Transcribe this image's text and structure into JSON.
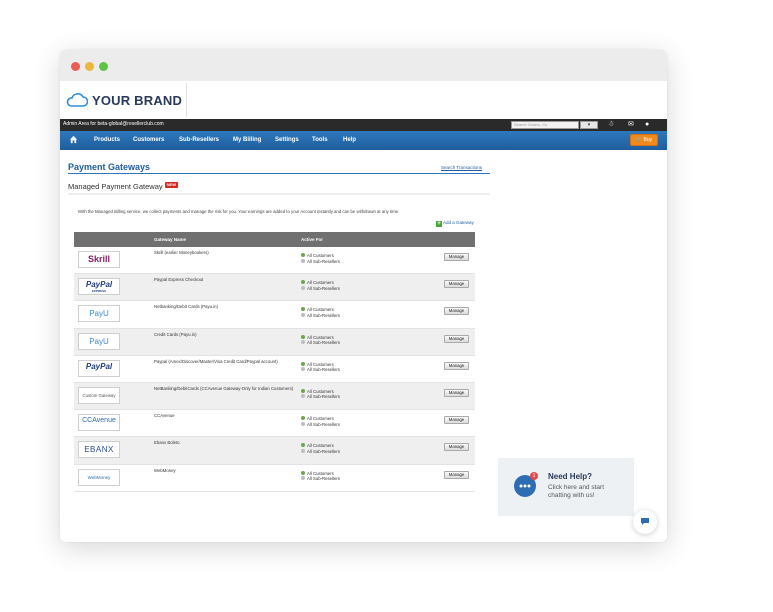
{
  "brand": {
    "name": "YOUR BRAND"
  },
  "admin_bar": {
    "text": "Admin Area for beta-global@resellerclub.com",
    "search_placeholder": "Search Orders, Cu",
    "search_button": "▾"
  },
  "nav": {
    "items": [
      "Products",
      "Customers",
      "Sub-Resellers",
      "My Billing",
      "Settings",
      "Tools",
      "Help"
    ],
    "buy_label": "🛒 Buy"
  },
  "page": {
    "title": "Payment Gateways",
    "search_transactions": "Search Transactions",
    "subtitle": "Managed Payment Gateway",
    "new_badge": "NEW",
    "description": "With the Managed Billing service, we collect payments and manage the risk for you. Your earnings are added to your Account instantly and can be withdrawn at any time.",
    "add_gateway": "Add a Gateway"
  },
  "table": {
    "headers": {
      "name": "Gateway Name",
      "active": "Active For"
    },
    "manage_label": "Manage",
    "rows": [
      {
        "logo": "Skrill",
        "name": "Skrill (earlier Moneybookers)",
        "active": [
          "All Customers",
          "All Sub-Resellers"
        ]
      },
      {
        "logo": "PayPal",
        "logo_sub": "EXPRESS",
        "name": "Paypal Express Checkout",
        "active": [
          "All Customers",
          "All Sub-Resellers"
        ]
      },
      {
        "logo": "PayU",
        "name": "Netbanking/Debit Cards (Payu.in)",
        "active": [
          "All Customers",
          "All Sub-Resellers"
        ]
      },
      {
        "logo": "PayU",
        "name": "Credit Cards (Payu.in)",
        "active": [
          "All Customers",
          "All Sub-Resellers"
        ]
      },
      {
        "logo": "PayPal",
        "name": "Paypal (Amex/Discover/Master/Visa Credit Card/Paypal account)",
        "active": [
          "All Customers",
          "All Sub-Resellers"
        ]
      },
      {
        "logo": "Custom Gateway",
        "name": "NetBanking/DebitCards (CCAvenue Gateway-Only for Indian Customers)",
        "active": [
          "All Customers",
          "All Sub-Resellers"
        ]
      },
      {
        "logo": "CCAvenue",
        "name": "CCAvenue",
        "active": [
          "All Customers",
          "All Sub-Resellers"
        ]
      },
      {
        "logo": "EBANX",
        "name": "Ebanx Boleto",
        "active": [
          "All Customers",
          "All Sub-Resellers"
        ]
      },
      {
        "logo": "WebMoney",
        "name": "WebMoney",
        "active": [
          "All Customers",
          "All Sub-Resellers"
        ]
      }
    ]
  },
  "help_widget": {
    "title": "Need Help?",
    "line1": "Click here and start",
    "line2": "chatting with us!",
    "badge": "1"
  },
  "colors": {
    "nav": "#1f5e9d",
    "buy": "#f08a1c",
    "brand": "#273a5b"
  }
}
